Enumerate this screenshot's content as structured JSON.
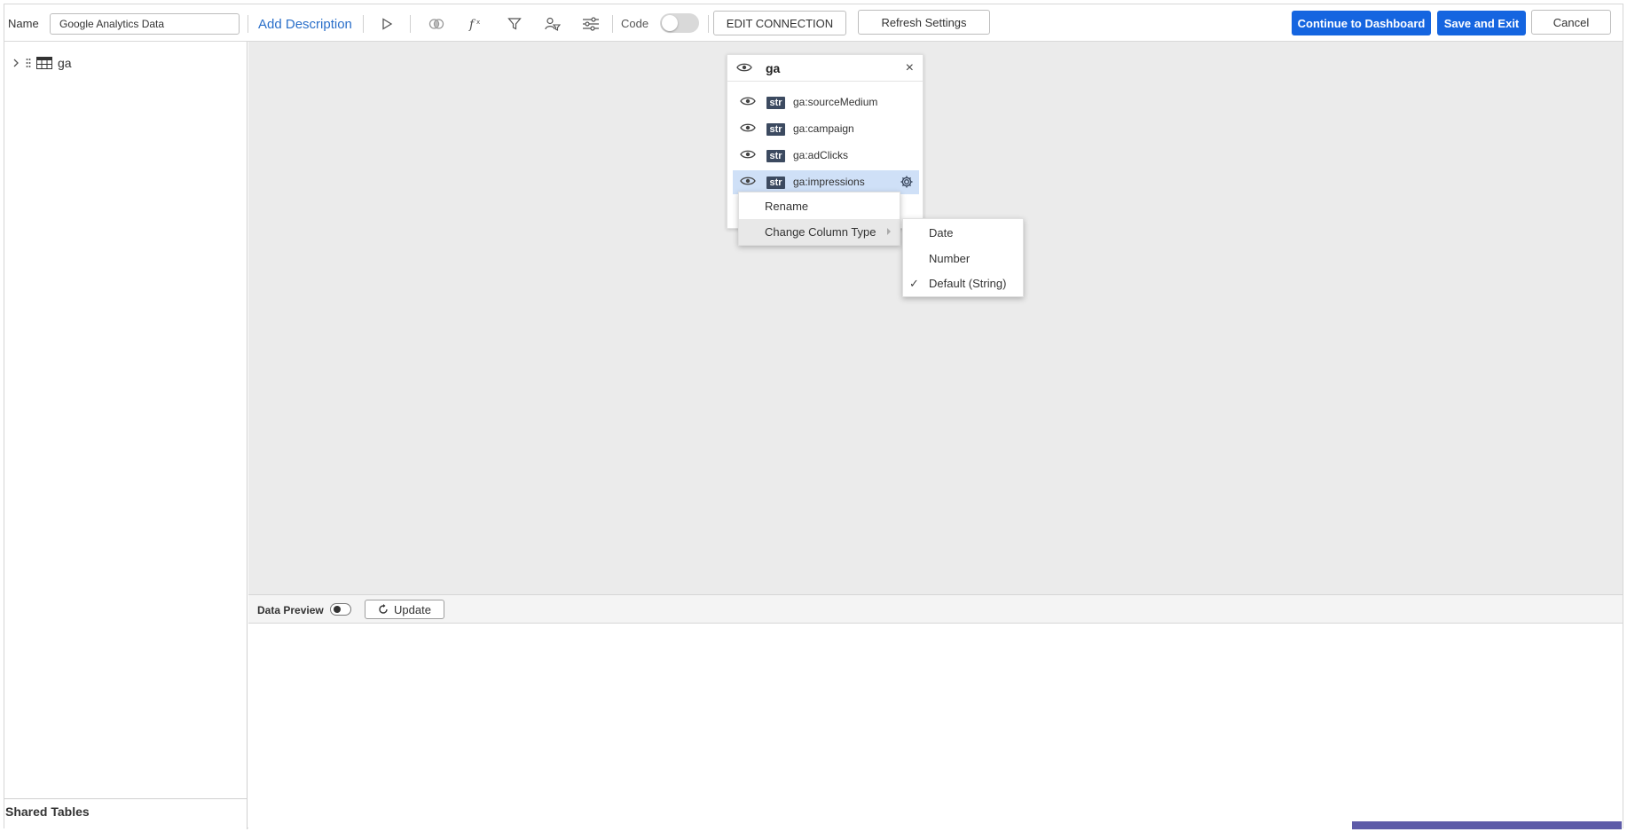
{
  "toolbar": {
    "name_label": "Name",
    "name_value": "Google Analytics Data",
    "add_description": "Add Description",
    "code_label": "Code",
    "code_enabled": false,
    "edit_connection": "EDIT CONNECTION",
    "refresh_settings": "Refresh Settings",
    "continue_dashboard": "Continue to Dashboard",
    "save_exit": "Save and Exit",
    "cancel": "Cancel",
    "icons": [
      "run-icon",
      "join-icon",
      "formula-icon",
      "filter-icon",
      "user-filter-icon",
      "settings-sliders-icon"
    ]
  },
  "left_panel": {
    "tree_item": "ga",
    "shared_tables": "Shared Tables"
  },
  "table_card": {
    "title": "ga",
    "close": "×",
    "columns": [
      {
        "type": "str",
        "name": "ga:sourceMedium"
      },
      {
        "type": "str",
        "name": "ga:campaign"
      },
      {
        "type": "str",
        "name": "ga:adClicks"
      },
      {
        "type": "str",
        "name": "ga:impressions",
        "selected": true
      }
    ]
  },
  "context_menu": {
    "items": [
      "Rename",
      "Change Column Type"
    ]
  },
  "column_type_menu": {
    "items": [
      "Date",
      "Number",
      "Default (String)"
    ],
    "checked": "Default (String)"
  },
  "preview": {
    "label": "Data Preview",
    "update": "Update"
  },
  "colors": {
    "primary": "#1565e0",
    "link": "#2a6fc9",
    "selected_row": "#cfe0f7",
    "canvas": "#ebebeb",
    "str_badge": "#3c4a60"
  }
}
